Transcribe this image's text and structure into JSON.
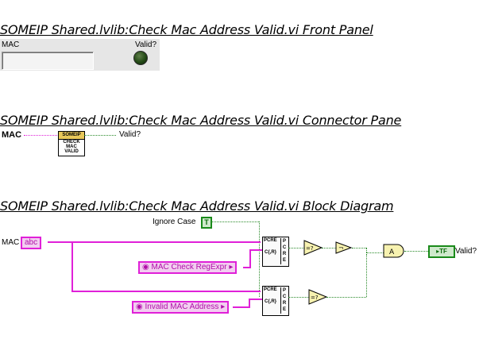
{
  "front_panel": {
    "title": "SOMEIP Shared.lvlib:Check Mac Address Valid.vi Front Panel",
    "mac_label": "MAC",
    "valid_label": "Valid?"
  },
  "connector_pane": {
    "title": "SOMEIP Shared.lvlib:Check Mac Address Valid.vi Connector Pane",
    "input_label": "MAC",
    "output_label": "Valid?",
    "icon_header": "SOMEIP",
    "icon_lines": [
      "CHECK",
      "MAC",
      "VALID"
    ]
  },
  "block_diagram": {
    "title": "SOMEIP Shared.lvlib:Check Mac Address Valid.vi Block Diagram",
    "mac_label": "MAC",
    "mac_terminal": "abc",
    "ignore_case_label": "Ignore Case",
    "ignore_case_value": "T",
    "const_regex_1": "MAC Check RegExpr",
    "const_regex_2": "Invalid MAC Address",
    "node_pcre_label": "PCRE",
    "node_pcre_sub": "C{,R}",
    "node_pcre_col": [
      "P",
      "C",
      "R",
      "E"
    ],
    "compare_1": "=?",
    "compare_2": "=?",
    "not_symbol": "¬",
    "and_symbol": "A",
    "valid_terminal": "TF",
    "valid_label": "Valid?"
  },
  "colors": {
    "string_wire": "#e020d8",
    "bool_wire": "#2a8a2a",
    "subvi_header": "#e9c85a"
  }
}
